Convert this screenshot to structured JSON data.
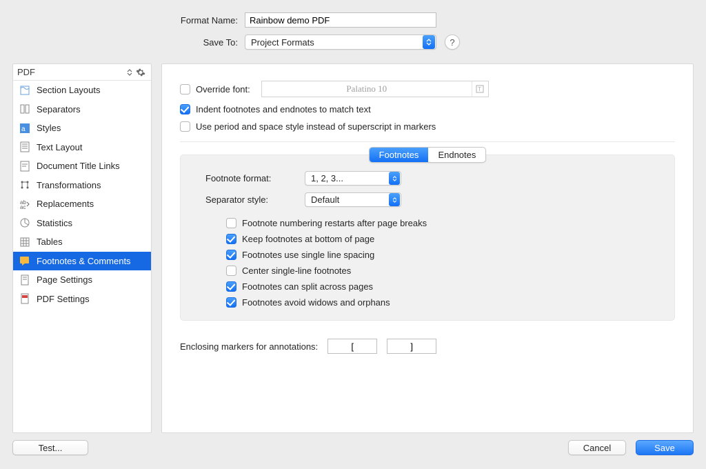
{
  "header": {
    "format_name_label": "Format Name:",
    "format_name_value": "Rainbow demo PDF",
    "save_to_label": "Save To:",
    "save_to_value": "Project Formats",
    "help_label": "?"
  },
  "sidebar": {
    "title": "PDF",
    "items": [
      {
        "label": "Section Layouts"
      },
      {
        "label": "Separators"
      },
      {
        "label": "Styles"
      },
      {
        "label": "Text Layout"
      },
      {
        "label": "Document Title Links"
      },
      {
        "label": "Transformations"
      },
      {
        "label": "Replacements"
      },
      {
        "label": "Statistics"
      },
      {
        "label": "Tables"
      },
      {
        "label": "Footnotes & Comments"
      },
      {
        "label": "Page Settings"
      },
      {
        "label": "PDF Settings"
      }
    ]
  },
  "main": {
    "override_font_label": "Override font:",
    "override_font_value": "Palatino 10",
    "indent_label": "Indent footnotes and endnotes to match text",
    "period_space_label": "Use period and space style instead of superscript in markers",
    "seg": {
      "left": "Footnotes",
      "right": "Endnotes"
    },
    "footnote_format_label": "Footnote format:",
    "footnote_format_value": "1, 2, 3...",
    "separator_style_label": "Separator style:",
    "separator_style_value": "Default",
    "opt": {
      "restart": "Footnote numbering restarts after page breaks",
      "keep_bottom": "Keep footnotes at bottom of page",
      "single_spacing": "Footnotes use single line spacing",
      "center_single": "Center single-line footnotes",
      "split_pages": "Footnotes can split across pages",
      "avoid_widows": "Footnotes avoid widows and orphans"
    },
    "annotations_label": "Enclosing markers for annotations:",
    "ann_open": "[",
    "ann_close": "]"
  },
  "footer": {
    "test": "Test...",
    "cancel": "Cancel",
    "save": "Save"
  }
}
